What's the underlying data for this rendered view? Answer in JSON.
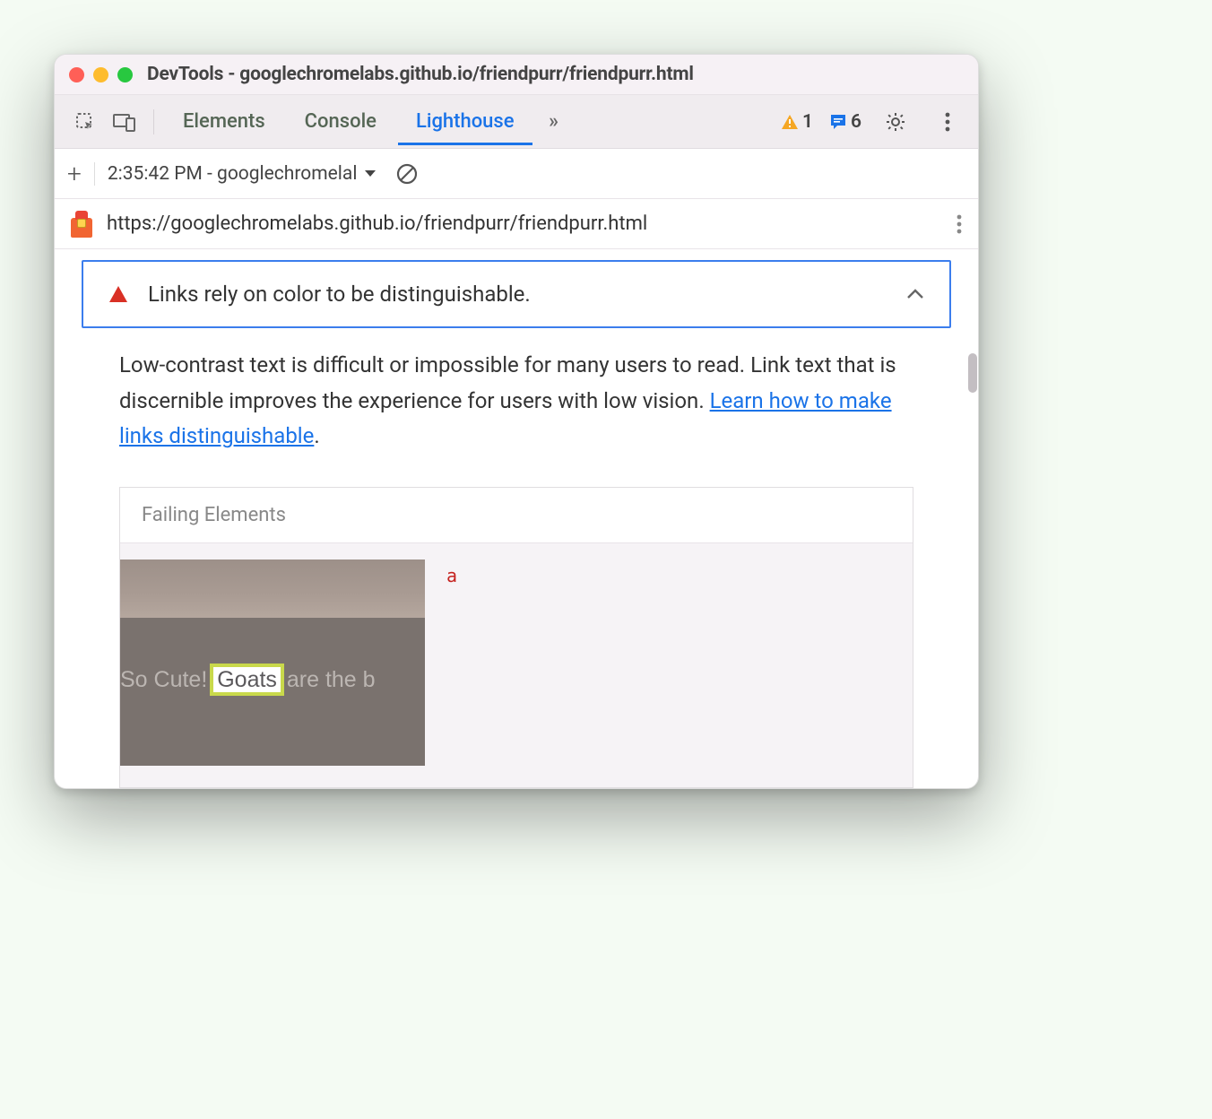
{
  "window": {
    "title": "DevTools - googlechromelabs.github.io/friendpurr/friendpurr.html"
  },
  "tabs": {
    "elements": "Elements",
    "console": "Console",
    "lighthouse": "Lighthouse"
  },
  "badges": {
    "warnings": "1",
    "messages": "6"
  },
  "subbar": {
    "run_label": "2:35:42 PM - googlechromelal"
  },
  "urlbar": {
    "url": "https://googlechromelabs.github.io/friendpurr/friendpurr.html"
  },
  "audit": {
    "title": "Links rely on color to be distinguishable.",
    "description_pre": "Low-contrast text is difficult or impossible for many users to read. Link text that is discernible improves the experience for users with low vision. ",
    "learn_link": "Learn how to make links distinguishable",
    "description_post": "."
  },
  "failing": {
    "header": "Failing Elements",
    "thumb_text_pre": "So Cute! ",
    "thumb_highlight": "Goats",
    "thumb_text_post": " are the b",
    "element_tag": "a"
  }
}
